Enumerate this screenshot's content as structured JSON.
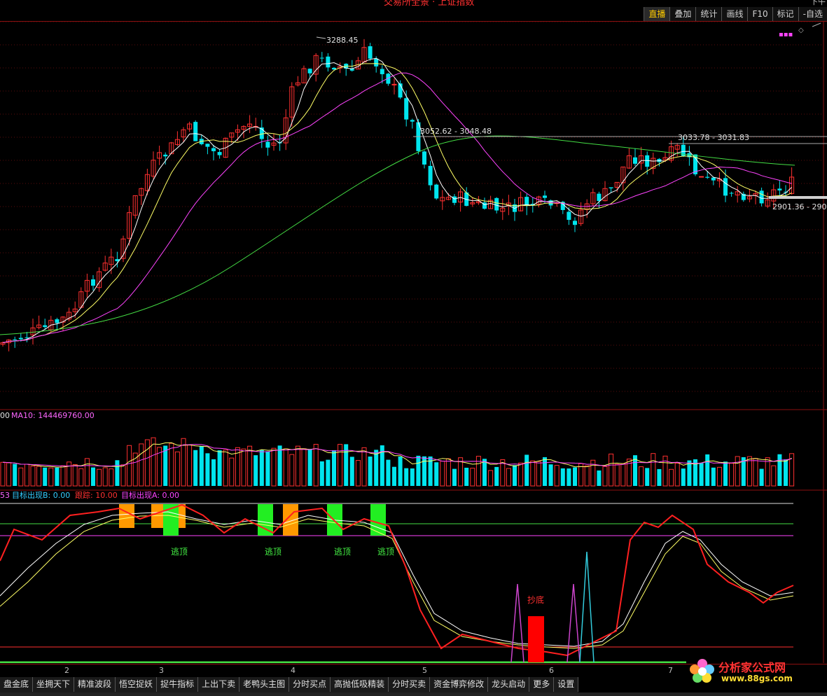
{
  "window": {
    "title": "交易所全景 · 上证指数",
    "right_text": "下午"
  },
  "toolbar": {
    "items": [
      {
        "label": "直播",
        "active": true
      },
      {
        "label": "叠加",
        "active": false
      },
      {
        "label": "统计",
        "active": false
      },
      {
        "label": "画线",
        "active": false
      },
      {
        "label": "F10",
        "active": false
      },
      {
        "label": "标记",
        "active": false
      },
      {
        "label": "-自选",
        "active": false
      }
    ]
  },
  "price_panel": {
    "annotations": {
      "high": "3288.45",
      "mid_left": "3052.62 - 3048.48",
      "mid_right": "3033.78 - 3031.83",
      "low_right": "2901.36 - 290"
    }
  },
  "volume_panel": {
    "legend_ma5": "00",
    "legend_ma10": "MA10: 144469760.00"
  },
  "indicator_panel": {
    "legend_prefix": "53",
    "legend_b": "目标出现B: 0.00",
    "legend_track": "跟踪: 10.00",
    "legend_a": "目标出现A: 0.00",
    "escape_label": "逃顶",
    "bottom_label": "抄底"
  },
  "xaxis": {
    "ticks": [
      "2",
      "3",
      "4",
      "5",
      "6",
      "7"
    ]
  },
  "bottom_tabs": [
    "盘金底",
    "坐拥天下",
    "精准波段",
    "悟空捉妖",
    "捉牛指标",
    "上出下卖",
    "老鸭头主图",
    "分时买点",
    "高抛低吸精装",
    "分时买卖",
    "资金博弈修改",
    "龙头启动",
    "更多",
    "设置"
  ],
  "watermark": {
    "site": "分析家公式网",
    "url": "www.88gs.com"
  },
  "colors": {
    "up": "#ff3030",
    "down": "#00e5ee",
    "ma_white": "#ffffff",
    "ma_yellow": "#ffff66",
    "ma_magenta": "#ff44ff",
    "ma_green": "#44dd44",
    "grid": "#8b1010"
  }
}
